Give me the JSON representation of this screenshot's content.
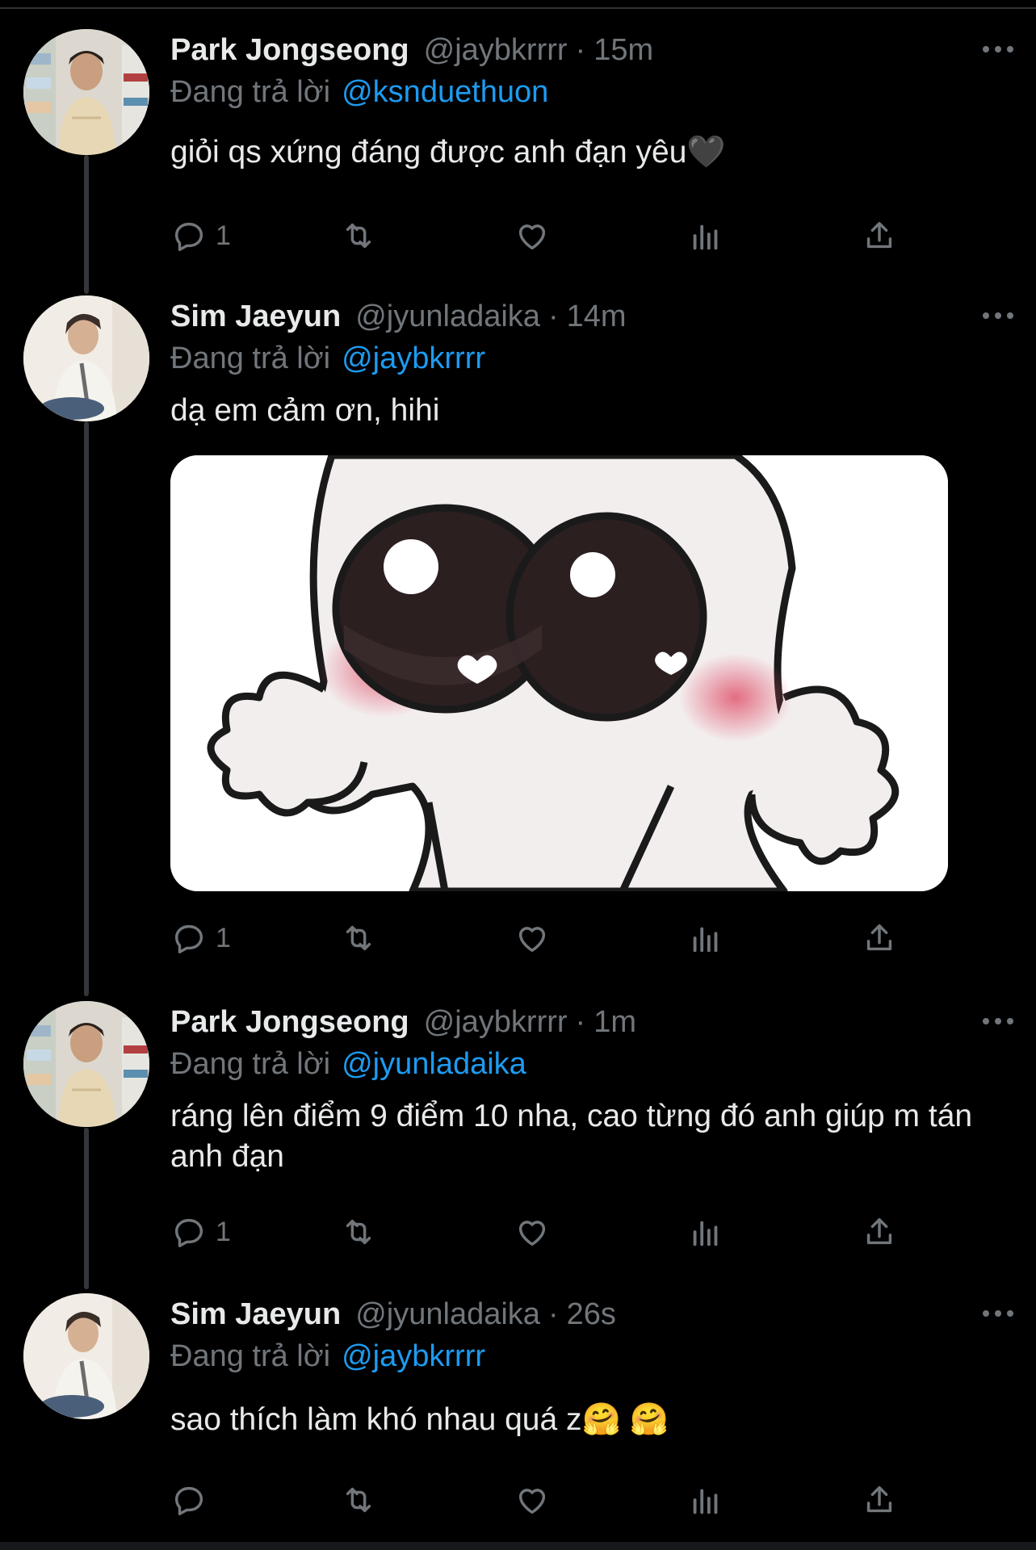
{
  "reply_prefix": "Đang trả lời",
  "colors": {
    "background": "#000000",
    "accent": "#1d9bf0",
    "muted": "#71767b",
    "text": "#e7e9ea"
  },
  "tweets": [
    {
      "name": "Park Jongseong",
      "handle": "@jaybkrrrr",
      "separator": "·",
      "time": "15m",
      "reply_to": "@ksnduethuon",
      "text": "giỏi qs xứng đáng được anh đạn yêu🖤",
      "reply_count": "1",
      "avatar_icon": "avatar-park-jongseong"
    },
    {
      "name": "Sim Jaeyun",
      "handle": "@jyunladaika",
      "separator": "·",
      "time": "14m",
      "reply_to": "@jaybkrrrr",
      "text": "dạ em cảm ơn, hihi",
      "reply_count": "1",
      "avatar_icon": "avatar-sim-jaeyun",
      "media": "blushing-cartoon-sticker"
    },
    {
      "name": "Park Jongseong",
      "handle": "@jaybkrrrr",
      "separator": "·",
      "time": "1m",
      "reply_to": "@jyunladaika",
      "text": "ráng lên điểm 9 điểm 10 nha, cao từng đó anh giúp m tán anh đạn",
      "reply_count": "1",
      "avatar_icon": "avatar-park-jongseong"
    },
    {
      "name": "Sim Jaeyun",
      "handle": "@jyunladaika",
      "separator": "·",
      "time": "26s",
      "reply_to": "@jaybkrrrr",
      "text": "sao thích làm khó nhau quá z🤗 🤗",
      "reply_count": "",
      "avatar_icon": "avatar-sim-jaeyun"
    }
  ],
  "action_icons": [
    "reply-icon",
    "retweet-icon",
    "like-icon",
    "analytics-icon",
    "share-icon"
  ]
}
